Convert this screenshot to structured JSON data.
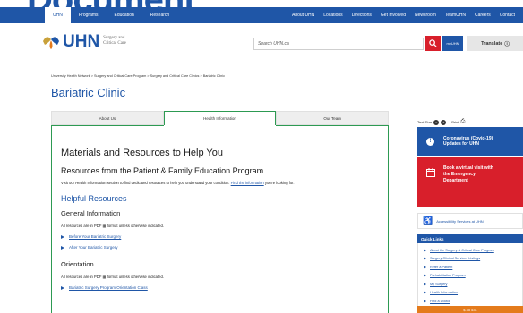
{
  "banner_fragment": "Document",
  "topnav": {
    "left": [
      "UHN",
      "Programs",
      "Education",
      "Research"
    ],
    "right": [
      "About UHN",
      "Locations",
      "Directions",
      "Get Involved",
      "Newsroom",
      "TeamUHN",
      "Careers",
      "Contact"
    ]
  },
  "header": {
    "logo_name": "UHN",
    "logo_sub_line1": "Surgery and",
    "logo_sub_line2": "Critical Care",
    "search_placeholder": "Search UHN.ca",
    "mychart_label": "myUHN",
    "translate_label": "Translate"
  },
  "breadcrumb": "University Health Network > Surgery and Critical Care Program > Surgery and Critical Care Clinics > Bariatric Clinic",
  "page_title": "Bariatric Clinic",
  "tabs": [
    "About Us",
    "Health Information",
    "Our Team"
  ],
  "content": {
    "heading": "Materials and Resources to Help You",
    "subheading": "Resources from the Patient & Family Education Program",
    "intro_before": "Visit our Health Information section to find dedicated resources to help you understand your condition.",
    "intro_link": "Find the information",
    "intro_after": "you're looking for.",
    "helpful": "Helpful Resources",
    "general_heading": "General Information",
    "general_note": "All resources are in PDF ▦ format unless otherwise indicated.",
    "general_links": [
      "Before Your Bariatric Surgery",
      "After Your Bariatric Surgery"
    ],
    "orientation_heading": "Orientation",
    "orientation_note": "All resources are in PDF ▦ format unless otherwise indicated.",
    "orientation_links": [
      "Bariatric Surgery Program Orientation Class"
    ]
  },
  "sidebar": {
    "text_size_label": "Text Size",
    "print_label": "Print",
    "covid_line1": "Coronavirus (Covid-19)",
    "covid_line2": "Updates for UHN",
    "er_line1": "Book a virtual visit with",
    "er_line2": "the Emergency",
    "er_line3": "Department",
    "accessibility": "Accessibility Services at UHN",
    "quick_links_title": "Quick Links",
    "quick_links": [
      "About the Surgery & Critical Care Program",
      "Surgery Clinical Services Listings",
      "Refer a Patient",
      "Prehabilitation Program",
      "My Surgery",
      "Health Information",
      "Find a Doctor",
      "Getting to UHN"
    ],
    "orange_label": "$ 35 531"
  },
  "colors": {
    "brand_blue": "#1f56a7",
    "accent_red": "#d81f2b",
    "tab_green": "#2d9a52",
    "orange": "#e47b1c"
  }
}
